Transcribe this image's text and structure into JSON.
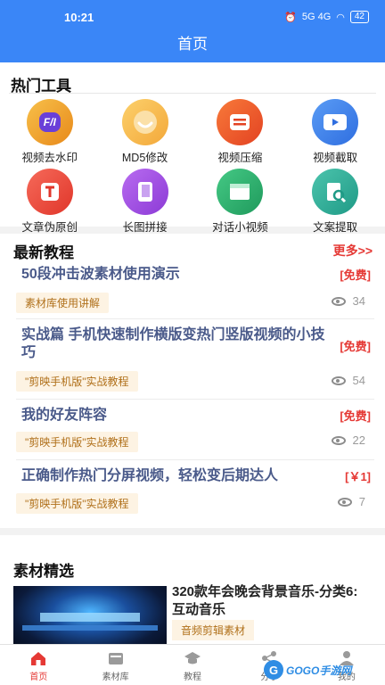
{
  "status_bar": {
    "time": "10:21",
    "signal": "5G 4G",
    "battery": "42"
  },
  "header": {
    "title": "首页"
  },
  "tools": {
    "title": "热门工具",
    "items": [
      {
        "label": "视频去水印",
        "icon": "watermark-remove-icon",
        "color": "#f3a31a",
        "glyph": "F/I"
      },
      {
        "label": "MD5修改",
        "icon": "smile-icon",
        "color": "#f7b84a",
        "glyph": "◡"
      },
      {
        "label": "视频压缩",
        "icon": "compress-icon",
        "color": "#f0592a",
        "glyph": "≡"
      },
      {
        "label": "视频截取",
        "icon": "video-clip-icon",
        "color": "#3d7ee8",
        "glyph": "▶"
      },
      {
        "label": "文章伪原创",
        "icon": "article-icon",
        "color": "#ef4a3d",
        "glyph": "T"
      },
      {
        "label": "长图拼接",
        "icon": "book-icon",
        "color": "#a24fe0",
        "glyph": "▯"
      },
      {
        "label": "对话小视频",
        "icon": "chat-video-icon",
        "color": "#2db36f",
        "glyph": "▭"
      },
      {
        "label": "文案提取",
        "icon": "text-extract-icon",
        "color": "#2aa68e",
        "glyph": "⌕"
      }
    ]
  },
  "tutorials": {
    "title": "最新教程",
    "more_label": "更多>>",
    "items": [
      {
        "title": "50段冲击波素材使用演示",
        "price": "[免费]",
        "tag": "素材库使用讲解",
        "views": "34"
      },
      {
        "title": "实战篇 手机快速制作横版变热门竖版视频的小技巧",
        "price": "[免费]",
        "tag": "\"剪映手机版\"实战教程",
        "views": "54"
      },
      {
        "title": "我的好友阵容",
        "price": "[免费]",
        "tag": "\"剪映手机版\"实战教程",
        "views": "22"
      },
      {
        "title": "正确制作热门分屏视频，轻松变后期达人",
        "price": "[￥1]",
        "tag": "\"剪映手机版\"实战教程",
        "views": "7"
      }
    ]
  },
  "materials": {
    "title": "素材精选",
    "items": [
      {
        "title": "320款年会晚会背景音乐-分类6: 互动音乐",
        "tag": "音频剪辑素材"
      }
    ]
  },
  "tabbar": {
    "items": [
      {
        "label": "首页",
        "icon": "home-icon",
        "active": true
      },
      {
        "label": "素材库",
        "icon": "library-icon",
        "active": false
      },
      {
        "label": "教程",
        "icon": "graduation-cap-icon",
        "active": false
      },
      {
        "label": "分享",
        "icon": "share-icon",
        "active": false
      },
      {
        "label": "我的",
        "icon": "user-icon",
        "active": false
      }
    ]
  },
  "watermark": {
    "text": "GOGO手游网"
  },
  "colors": {
    "primary": "#3a86f7",
    "accent_red": "#e53935",
    "tag_bg": "#fdf3e3",
    "tag_text": "#b0701a",
    "title_blue": "#4a5a8a"
  }
}
